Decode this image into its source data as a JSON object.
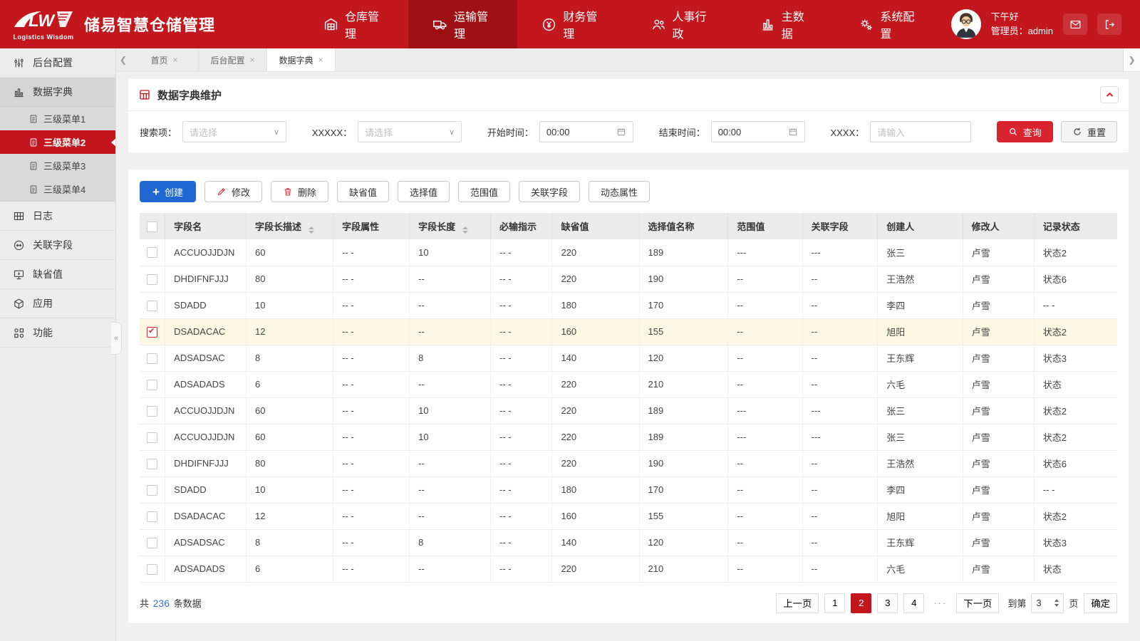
{
  "colors": {
    "brand_red": "#c3161c",
    "nav_active_red": "#9e1014",
    "query_red": "#d9232e",
    "create_blue": "#1f67d2",
    "selected_row_bg": "#fdf7e3",
    "link_blue": "#3a6fd8"
  },
  "brand": {
    "logo_text": "LW",
    "logo_subtext": "Logistics Wisdom",
    "app_title": "储易智慧仓储管理"
  },
  "top_nav": {
    "items": [
      {
        "id": "warehouse",
        "label": "仓库管理",
        "icon": "warehouse-icon",
        "active": false
      },
      {
        "id": "transport",
        "label": "运输管理",
        "icon": "truck-icon",
        "active": true
      },
      {
        "id": "finance",
        "label": "财务管理",
        "icon": "finance-icon",
        "active": false
      },
      {
        "id": "hr",
        "label": "人事行政",
        "icon": "people-icon",
        "active": false
      },
      {
        "id": "master-data",
        "label": "主数据",
        "icon": "chart-icon",
        "active": false
      },
      {
        "id": "system-config",
        "label": "系统配置",
        "icon": "gear-icon",
        "active": false
      }
    ]
  },
  "user": {
    "greeting": "下午好",
    "role_line": "管理员：admin"
  },
  "sidebar": {
    "collapse_glyph": "«",
    "items": [
      {
        "id": "backend-config",
        "label": "后台配置",
        "icon": "sliders-icon"
      },
      {
        "id": "data-dictionary",
        "label": "数据字典",
        "icon": "bars-icon",
        "expanded": true,
        "children": [
          {
            "id": "menu3-1",
            "label": "三级菜单1",
            "active": false
          },
          {
            "id": "menu3-2",
            "label": "三级菜单2",
            "active": true
          },
          {
            "id": "menu3-3",
            "label": "三级菜单3",
            "active": false
          },
          {
            "id": "menu3-4",
            "label": "三级菜单4",
            "active": false
          }
        ]
      },
      {
        "id": "logs",
        "label": "日志",
        "icon": "log-icon"
      },
      {
        "id": "related-fields",
        "label": "关联字段",
        "icon": "link-icon"
      },
      {
        "id": "default-values",
        "label": "缺省值",
        "icon": "monitor-icon"
      },
      {
        "id": "applications",
        "label": "应用",
        "icon": "app-icon"
      },
      {
        "id": "functions",
        "label": "功能",
        "icon": "dots-icon"
      }
    ]
  },
  "tabs": {
    "close_glyph": "×",
    "left_arrow": "❮",
    "right_arrow": "❯",
    "items": [
      {
        "id": "home",
        "label": "首页",
        "active": false
      },
      {
        "id": "backend-config",
        "label": "后台配置",
        "active": false
      },
      {
        "id": "data-dictionary",
        "label": "数据字典",
        "active": true
      }
    ]
  },
  "panel": {
    "title": "数据字典维护",
    "collapse_glyph": "⌃"
  },
  "filters": {
    "search_item": {
      "label": "搜索项：",
      "placeholder": "请选择"
    },
    "xxxxx": {
      "label": "XXXXX：",
      "placeholder": "请选择"
    },
    "start_time": {
      "label": "开始时间：",
      "value": "00:00"
    },
    "end_time": {
      "label": "结束时间：",
      "value": "00:00"
    },
    "xxxx": {
      "label": "XXXX：",
      "placeholder": "请输入"
    },
    "query_label": "查询",
    "reset_label": "重置"
  },
  "actions": [
    {
      "id": "create",
      "label": "创建",
      "icon": "plus-icon",
      "style": "primary"
    },
    {
      "id": "edit",
      "label": "修改",
      "icon": "pencil-icon",
      "style": "default"
    },
    {
      "id": "delete",
      "label": "删除",
      "icon": "trash-icon",
      "style": "default"
    },
    {
      "id": "default-value",
      "label": "缺省值",
      "style": "default"
    },
    {
      "id": "select-value",
      "label": "选择值",
      "style": "default"
    },
    {
      "id": "range-value",
      "label": "范围值",
      "style": "default"
    },
    {
      "id": "related-field",
      "label": "关联字段",
      "style": "default"
    },
    {
      "id": "dynamic-attr",
      "label": "动态属性",
      "style": "default"
    }
  ],
  "table": {
    "columns": [
      {
        "key": "checkbox",
        "label": "",
        "width": "2.6%"
      },
      {
        "key": "name",
        "label": "字段名",
        "width": "8.3%"
      },
      {
        "key": "len_desc",
        "label": "字段长描述",
        "width": "8.9%",
        "sortable": true
      },
      {
        "key": "attr",
        "label": "字段属性",
        "width": "7.8%"
      },
      {
        "key": "length",
        "label": "字段长度",
        "width": "8.3%",
        "sortable": true
      },
      {
        "key": "required",
        "label": "必输指示",
        "width": "6.3%"
      },
      {
        "key": "default",
        "label": "缺省值",
        "width": "8.9%"
      },
      {
        "key": "select_name",
        "label": "选择值名称",
        "width": "9.1%"
      },
      {
        "key": "range",
        "label": "范围值",
        "width": "7.6%"
      },
      {
        "key": "related",
        "label": "关联字段",
        "width": "7.7%"
      },
      {
        "key": "creator",
        "label": "创建人",
        "width": "8.7%"
      },
      {
        "key": "modifier",
        "label": "修改人",
        "width": "7.3%"
      },
      {
        "key": "status",
        "label": "记录状态",
        "width": "8.5%"
      }
    ],
    "rows": [
      {
        "checked": false,
        "name": "ACCUOJJDJN",
        "len_desc": "60",
        "attr": "-- -",
        "length": "10",
        "required": "-- -",
        "default": "220",
        "select_name": "189",
        "range": "---",
        "related": "---",
        "creator": "张三",
        "modifier": "卢雪",
        "status": "状态2"
      },
      {
        "checked": false,
        "name": "DHDIFNFJJJ",
        "len_desc": "80",
        "attr": "-- -",
        "length": "--",
        "required": "-- -",
        "default": "220",
        "select_name": "190",
        "range": "--",
        "related": "--",
        "creator": "王浩然",
        "modifier": "卢雪",
        "status": "状态6"
      },
      {
        "checked": false,
        "name": "SDADD",
        "len_desc": "10",
        "attr": "-- -",
        "length": "--",
        "required": "-- -",
        "default": "180",
        "select_name": "170",
        "range": "--",
        "related": "--",
        "creator": "李四",
        "modifier": "卢雪",
        "status": "-- -"
      },
      {
        "checked": true,
        "name": "DSADACAC",
        "len_desc": "12",
        "attr": "-- -",
        "length": "--",
        "required": "-- -",
        "default": "160",
        "select_name": "155",
        "range": "--",
        "related": "--",
        "creator": "旭阳",
        "modifier": "卢雪",
        "status": "状态2"
      },
      {
        "checked": false,
        "name": "ADSADSAC",
        "len_desc": "8",
        "attr": "-- -",
        "length": "8",
        "required": "-- -",
        "default": "140",
        "select_name": "120",
        "range": "--",
        "related": "--",
        "creator": "王东辉",
        "modifier": "卢雪",
        "status": "状态3"
      },
      {
        "checked": false,
        "name": "ADSADADS",
        "len_desc": "6",
        "attr": "-- -",
        "length": "--",
        "required": "-- -",
        "default": "220",
        "select_name": "210",
        "range": "--",
        "related": "--",
        "creator": "六毛",
        "modifier": "卢雪",
        "status": "状态"
      },
      {
        "checked": false,
        "name": "ACCUOJJDJN",
        "len_desc": "60",
        "attr": "-- -",
        "length": "10",
        "required": "-- -",
        "default": "220",
        "select_name": "189",
        "range": "---",
        "related": "---",
        "creator": "张三",
        "modifier": "卢雪",
        "status": "状态2"
      },
      {
        "checked": false,
        "name": "ACCUOJJDJN",
        "len_desc": "60",
        "attr": "-- -",
        "length": "10",
        "required": "-- -",
        "default": "220",
        "select_name": "189",
        "range": "---",
        "related": "---",
        "creator": "张三",
        "modifier": "卢雪",
        "status": "状态2"
      },
      {
        "checked": false,
        "name": "DHDIFNFJJJ",
        "len_desc": "80",
        "attr": "-- -",
        "length": "--",
        "required": "-- -",
        "default": "220",
        "select_name": "190",
        "range": "--",
        "related": "--",
        "creator": "王浩然",
        "modifier": "卢雪",
        "status": "状态6"
      },
      {
        "checked": false,
        "name": "SDADD",
        "len_desc": "10",
        "attr": "-- -",
        "length": "--",
        "required": "-- -",
        "default": "180",
        "select_name": "170",
        "range": "--",
        "related": "--",
        "creator": "李四",
        "modifier": "卢雪",
        "status": "-- -"
      },
      {
        "checked": false,
        "name": "DSADACAC",
        "len_desc": "12",
        "attr": "-- -",
        "length": "--",
        "required": "-- -",
        "default": "160",
        "select_name": "155",
        "range": "--",
        "related": "--",
        "creator": "旭阳",
        "modifier": "卢雪",
        "status": "状态2"
      },
      {
        "checked": false,
        "name": "ADSADSAC",
        "len_desc": "8",
        "attr": "-- -",
        "length": "8",
        "required": "-- -",
        "default": "140",
        "select_name": "120",
        "range": "--",
        "related": "--",
        "creator": "王东辉",
        "modifier": "卢雪",
        "status": "状态3"
      },
      {
        "checked": false,
        "name": "ADSADADS",
        "len_desc": "6",
        "attr": "-- -",
        "length": "--",
        "required": "-- -",
        "default": "220",
        "select_name": "210",
        "range": "--",
        "related": "--",
        "creator": "六毛",
        "modifier": "卢雪",
        "status": "状态"
      }
    ]
  },
  "pagination": {
    "total_prefix": "共",
    "total": "236",
    "total_suffix": "条数据",
    "prev": "上一页",
    "pages": [
      "1",
      "2",
      "3",
      "4"
    ],
    "active_page": "2",
    "ellipsis": "···",
    "next": "下一页",
    "goto_prefix": "到第",
    "goto_value": "3",
    "goto_suffix": "页",
    "confirm": "确定"
  }
}
